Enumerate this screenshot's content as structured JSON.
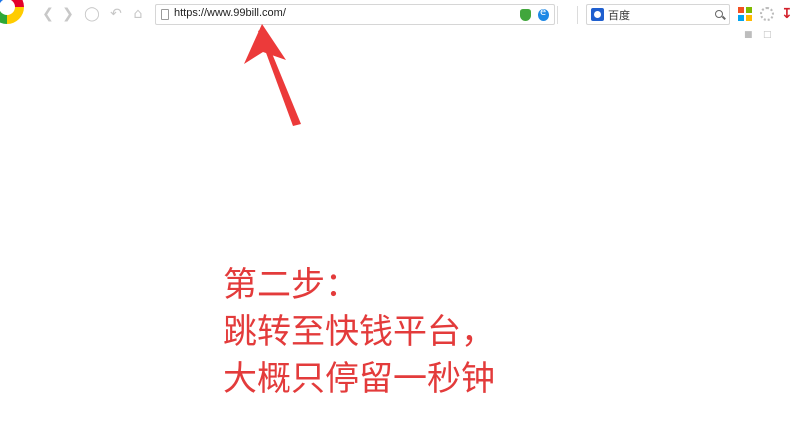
{
  "browser": {
    "address_url": "https://www.99bill.com/",
    "search_engine_label": "百度"
  },
  "icons": {
    "logo": "360-browser-logo",
    "back": "back-arrow-icon",
    "forward": "forward-arrow-icon",
    "stop": "stop-icon",
    "undo": "undo-close-tab-icon",
    "home": "home-icon",
    "page": "page-icon",
    "shield": "security-shield-icon",
    "ie_mode": "ie-mode-icon",
    "search": "search-icon",
    "tiles": "apps-grid-icon",
    "gear": "settings-icon",
    "download": "download-icon"
  },
  "annotation": {
    "lines": [
      "第二步：",
      "跳转至快钱平台，",
      "大概只停留一秒钟"
    ],
    "color": "#e33b3b"
  }
}
